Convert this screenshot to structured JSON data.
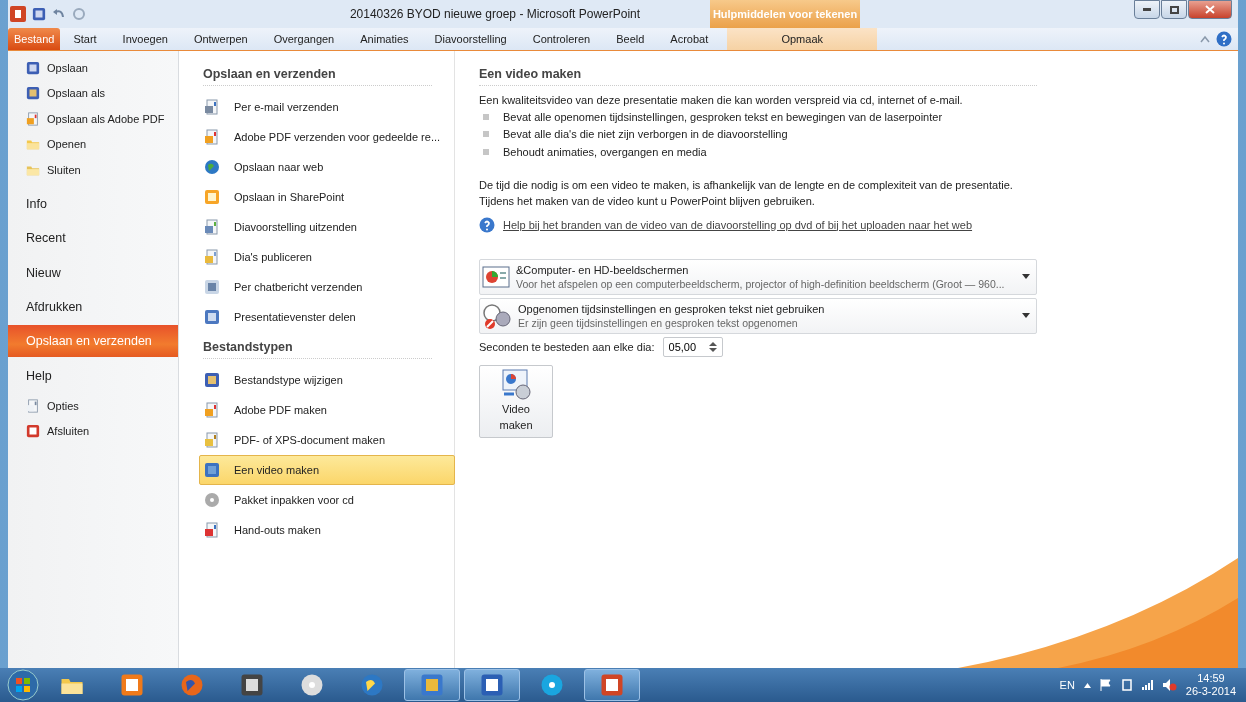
{
  "window": {
    "title": "20140326 BYOD nieuwe groep  -  Microsoft PowerPoint",
    "context_group": "Hulpmiddelen voor tekenen"
  },
  "ribbon": {
    "tabs": [
      {
        "label": "Bestand",
        "selected": true
      },
      {
        "label": "Start",
        "selected": false
      },
      {
        "label": "Invoegen",
        "selected": false
      },
      {
        "label": "Ontwerpen",
        "selected": false
      },
      {
        "label": "Overgangen",
        "selected": false
      },
      {
        "label": "Animaties",
        "selected": false
      },
      {
        "label": "Diavoorstelling",
        "selected": false
      },
      {
        "label": "Controleren",
        "selected": false
      },
      {
        "label": "Beeld",
        "selected": false
      },
      {
        "label": "Acrobat",
        "selected": false
      }
    ],
    "context_tab": {
      "label": "Opmaak",
      "selected": false
    }
  },
  "backstage_nav": [
    {
      "label": "Opslaan",
      "kind": "command",
      "selected": false
    },
    {
      "label": "Opslaan als",
      "kind": "command",
      "selected": false
    },
    {
      "label": "Opslaan als Adobe PDF",
      "kind": "command",
      "selected": false
    },
    {
      "label": "Openen",
      "kind": "command",
      "selected": false
    },
    {
      "label": "Sluiten",
      "kind": "command",
      "selected": false
    },
    {
      "label": "Info",
      "kind": "page",
      "selected": false
    },
    {
      "label": "Recent",
      "kind": "page",
      "selected": false
    },
    {
      "label": "Nieuw",
      "kind": "page",
      "selected": false
    },
    {
      "label": "Afdrukken",
      "kind": "page",
      "selected": false
    },
    {
      "label": "Opslaan en verzenden",
      "kind": "page",
      "selected": true
    },
    {
      "label": "Help",
      "kind": "page",
      "selected": false
    },
    {
      "label": "Opties",
      "kind": "command",
      "selected": false
    },
    {
      "label": "Afsluiten",
      "kind": "command",
      "selected": false
    }
  ],
  "sections": [
    {
      "heading": "Opslaan en verzenden",
      "items": [
        {
          "label": "Per e-mail verzenden",
          "selected": false
        },
        {
          "label": "Adobe PDF verzenden voor gedeelde re...",
          "selected": false
        },
        {
          "label": "Opslaan naar web",
          "selected": false
        },
        {
          "label": "Opslaan in SharePoint",
          "selected": false
        },
        {
          "label": "Diavoorstelling uitzenden",
          "selected": false
        },
        {
          "label": "Dia's publiceren",
          "selected": false
        },
        {
          "label": "Per chatbericht verzenden",
          "selected": false
        },
        {
          "label": "Presentatievenster delen",
          "selected": false
        }
      ]
    },
    {
      "heading": "Bestandstypen",
      "items": [
        {
          "label": "Bestandstype wijzigen",
          "selected": false
        },
        {
          "label": "Adobe PDF maken",
          "selected": false
        },
        {
          "label": "PDF- of XPS-document maken",
          "selected": false
        },
        {
          "label": "Een video maken",
          "selected": true
        },
        {
          "label": "Pakket inpakken voor cd",
          "selected": false
        },
        {
          "label": "Hand-outs maken",
          "selected": false
        }
      ]
    }
  ],
  "detail": {
    "heading": "Een video maken",
    "intro": "Een kwaliteitsvideo van deze presentatie maken die kan worden verspreid via cd, internet of e-mail.",
    "bullets": [
      "Bevat alle openomen tijdsinstellingen, gesproken tekst en bewegingen van de laserpointer",
      "Bevat alle dia's die niet zijn verborgen in de diavoorstelling",
      "Behoudt animaties, overgangen en media"
    ],
    "note": [
      "De tijd die nodig is om een video te maken, is afhankelijk van de lengte en de complexiteit van de presentatie.",
      "Tijdens het maken van de video kunt u PowerPoint blijven gebruiken."
    ],
    "help_link": "Help bij het branden van de video van de diavoorstelling op dvd of bij het uploaden naar het web",
    "dropdowns": [
      {
        "title": "&Computer- en HD-beeldschermen",
        "subtitle": "Voor het afspelen op een computerbeeldscherm, projector of high-definition beeldscherm (Groot — 960..."
      },
      {
        "title": "Opgenomen tijdsinstellingen en gesproken tekst niet gebruiken",
        "subtitle": "Er zijn geen tijdsinstellingen en gesproken tekst opgenomen"
      }
    ],
    "seconds": {
      "label": "Seconden te besteden aan elke dia:",
      "value": "05,00"
    },
    "create_button": {
      "line1": "Video",
      "line2": "maken"
    }
  },
  "taskbar": {
    "language": "EN",
    "time": "14:59",
    "date": "26-3-2014"
  }
}
